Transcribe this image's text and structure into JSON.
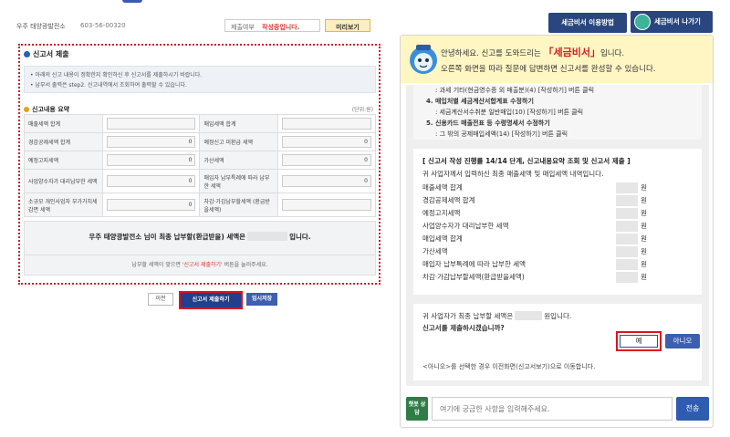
{
  "top": {
    "company": "우주 태양광발전소",
    "bizno": "603-56-00320",
    "status_label": "제출여부",
    "status_value": "작성중입니다.",
    "preview_btn": "미리보기"
  },
  "section": {
    "title": "신고서 제출",
    "notice_lines": [
      "아래의 신고 내용이 정확한지 확인하신 후 신고서를 제출하시기 바랍니다.",
      "납부서 출력은 step2. 신고내역에서 조회하여 출력할 수 있습니다."
    ],
    "summary_title": "신고내용 요약",
    "unit": "(단위:원)"
  },
  "summary": {
    "rows": [
      {
        "l1": "매출세액 합계",
        "v1": "",
        "l2": "매입세액 합계",
        "v2": ""
      },
      {
        "l1": "경감공제세액 합계",
        "v1": "0",
        "l2": "예정신고 미환급 세액",
        "v2": "0"
      },
      {
        "l1": "예정고지세액",
        "v1": "0",
        "l2": "가산세액",
        "v2": "0"
      },
      {
        "l1": "사업양수자가 대리납부한 세액",
        "v1": "0",
        "l2": "매입자 납부특례에 따라 납부한 세액",
        "v2": "0"
      },
      {
        "l1": "소규모 개인사업자 부가가치세 감면 세액",
        "v1": "0",
        "l2": "차감·가감납부할세액 (환급받을세액)",
        "v2": ""
      }
    ]
  },
  "final": {
    "prefix": "우주 태양광발전소 님이 최종 납부할(환급받을) 세액은",
    "suffix": "입니다.",
    "hint_pre": "납부할 세액이 맞으면 ",
    "hint_red": "'신고서 제출하기'",
    "hint_post": " 버튼을 눌러주세요."
  },
  "buttons": {
    "prev": "이전",
    "submit": "신고서 제출하기",
    "save": "임시저장"
  },
  "header": {
    "guide_btn": "세금비서 이용방법",
    "exit_btn": "세금비서 나가기"
  },
  "greet": {
    "line1_pre": "안녕하세요. 신고를 도와드리는 ",
    "brand": "「세금비서」",
    "line1_post": "입니다.",
    "line2": "오른쪽 화면을 따라 질문에 답변하면 신고서를 완성할 수 있습니다."
  },
  "bubble1": {
    "l1": ": 과세 기타(현금영수증 외 매출분)(4) [작성하기] 버튼 클릭",
    "h2": "4. 매입처별 세금계산서합계표 수정하기",
    "l2": ": 세금계산서수취분 일반매입(10) [작성하기] 버튼 클릭",
    "h3": "5. 신용카드 매출전표 등 수령명세서 수정하기",
    "l3": ": 그 밖의 공제매입세액(14) [작성하기] 버튼 클릭"
  },
  "bubble2": {
    "title": "[ 신고서 작성 진행률 14/14 단계, 신고내용요약 조회 및 신고서 제출 ]",
    "intro": "귀 사업자께서 입력하신 최종 매출세액 및 매입세액 내역입니다.",
    "won": "원",
    "rows": [
      "매출세액 합계",
      "경감공제세액 합계",
      "예정고지세액",
      "사업양수자가 대리납부한 세액",
      "매입세액 합계",
      "가산세액",
      "매입자 납부특례에 따라 납부한 세액",
      "차감·가감납부할세액(환급받을세액)"
    ]
  },
  "bubble3": {
    "q1_pre": "귀 사업자가 최종 납부할 세액은",
    "q1_post": "원입니다.",
    "q2": "신고서를 제출하시겠습니까?",
    "yes": "예",
    "no": "아니오",
    "q3": "<아니오>를 선택한 경우 이전화면(신고서보기)으로 이동합니다."
  },
  "input": {
    "bot_label": "챗봇 상담",
    "placeholder": "여기에 궁금한 사항을 입력해주세요.",
    "send": "전송"
  }
}
